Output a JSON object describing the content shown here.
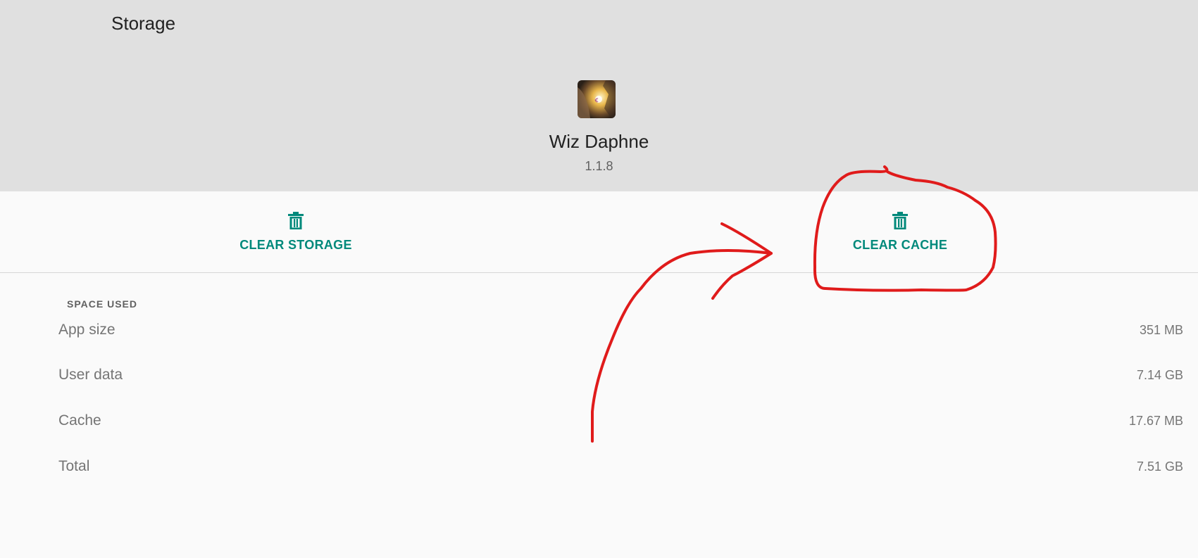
{
  "header": {
    "title": "Storage"
  },
  "app": {
    "name": "Wiz Daphne",
    "version": "1.1.8",
    "icon": "app-icon"
  },
  "actions": {
    "clear_storage": "CLEAR STORAGE",
    "clear_cache": "CLEAR CACHE",
    "icon": "trash-icon"
  },
  "space_used": {
    "header": "SPACE USED",
    "rows": [
      {
        "label": "App size",
        "value": "351 MB"
      },
      {
        "label": "User data",
        "value": "7.14 GB"
      },
      {
        "label": "Cache",
        "value": "17.67 MB"
      },
      {
        "label": "Total",
        "value": "7.51 GB"
      }
    ]
  },
  "colors": {
    "accent": "#00897b",
    "header_bg": "#e0e0e0",
    "annotation": "#e01b1b"
  }
}
